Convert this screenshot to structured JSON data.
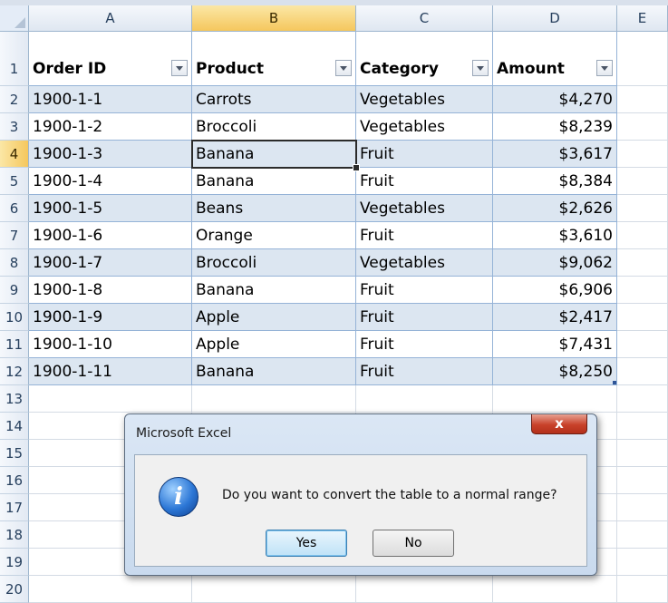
{
  "columns": [
    "A",
    "B",
    "C",
    "D",
    "E"
  ],
  "active_column": "B",
  "active_row": 4,
  "row_numbers": [
    1,
    2,
    3,
    4,
    5,
    6,
    7,
    8,
    9,
    10,
    11,
    12,
    13,
    14,
    15,
    16,
    17,
    18,
    19,
    20
  ],
  "table": {
    "headers": [
      "Order ID",
      "Product",
      "Category",
      "Amount"
    ],
    "rows": [
      [
        "1900-1-1",
        "Carrots",
        "Vegetables",
        "$4,270"
      ],
      [
        "1900-1-2",
        "Broccoli",
        "Vegetables",
        "$8,239"
      ],
      [
        "1900-1-3",
        "Banana",
        "Fruit",
        "$3,617"
      ],
      [
        "1900-1-4",
        "Banana",
        "Fruit",
        "$8,384"
      ],
      [
        "1900-1-5",
        "Beans",
        "Vegetables",
        "$2,626"
      ],
      [
        "1900-1-6",
        "Orange",
        "Fruit",
        "$3,610"
      ],
      [
        "1900-1-7",
        "Broccoli",
        "Vegetables",
        "$9,062"
      ],
      [
        "1900-1-8",
        "Banana",
        "Fruit",
        "$6,906"
      ],
      [
        "1900-1-9",
        "Apple",
        "Fruit",
        "$2,417"
      ],
      [
        "1900-1-10",
        "Apple",
        "Fruit",
        "$7,431"
      ],
      [
        "1900-1-11",
        "Banana",
        "Fruit",
        "$8,250"
      ]
    ]
  },
  "dialog": {
    "title": "Microsoft Excel",
    "close_label": "x",
    "message": "Do you want to convert the table to a normal range?",
    "yes_label": "Yes",
    "no_label": "No",
    "icon": "info-icon"
  },
  "colors": {
    "band": "#dce6f1",
    "table_border": "#95b3d7",
    "header_highlight": "#f5c75d"
  }
}
